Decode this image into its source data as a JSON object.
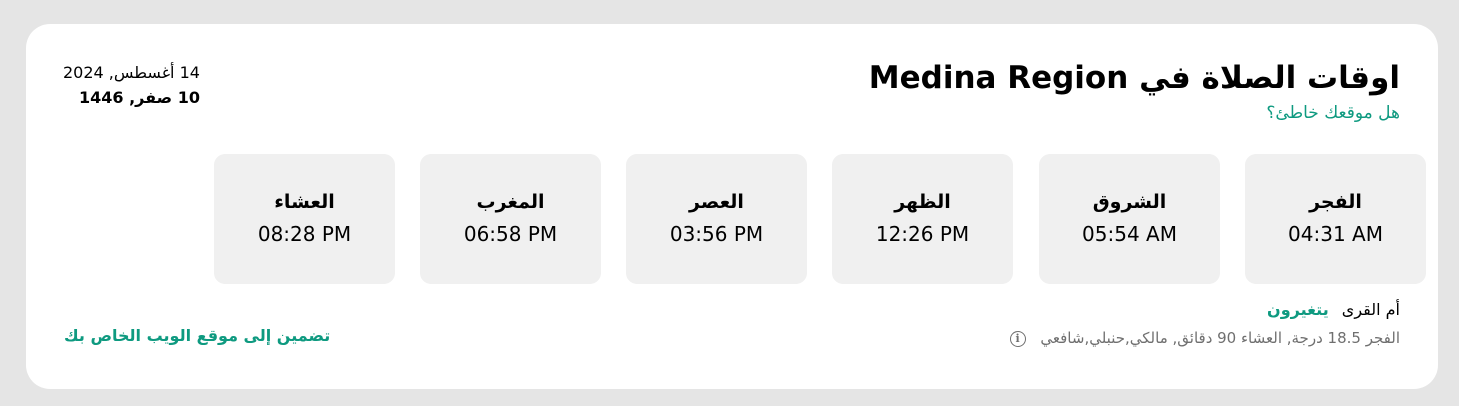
{
  "header": {
    "title": "اوقات الصلاة في Medina Region",
    "wrong_location": "هل موقعك خاطئ؟"
  },
  "dates": {
    "gregorian": "14 أغسطس, 2024",
    "hijri": "10 صفر, 1446"
  },
  "prayers": [
    {
      "name": "الفجر",
      "time": "04:31 AM"
    },
    {
      "name": "الشروق",
      "time": "05:54 AM"
    },
    {
      "name": "الظهر",
      "time": "12:26 PM"
    },
    {
      "name": "العصر",
      "time": "03:56 PM"
    },
    {
      "name": "المغرب",
      "time": "06:58 PM"
    },
    {
      "name": "العشاء",
      "time": "08:28 PM"
    }
  ],
  "method": {
    "name": "أم القرى",
    "change_label": "يتغيرون",
    "details": "الفجر 18.5 درجة, العشاء 90 دقائق, مالكي,حنبلي,شافعي",
    "info_icon": "info-icon"
  },
  "embed": {
    "label": "تضمين إلى موقع الويب الخاص بك"
  },
  "colors": {
    "accent": "#0e9a80",
    "card_bg": "#ffffff",
    "page_bg": "#e5e5e5",
    "prayer_box_bg": "#f0f0f0"
  }
}
